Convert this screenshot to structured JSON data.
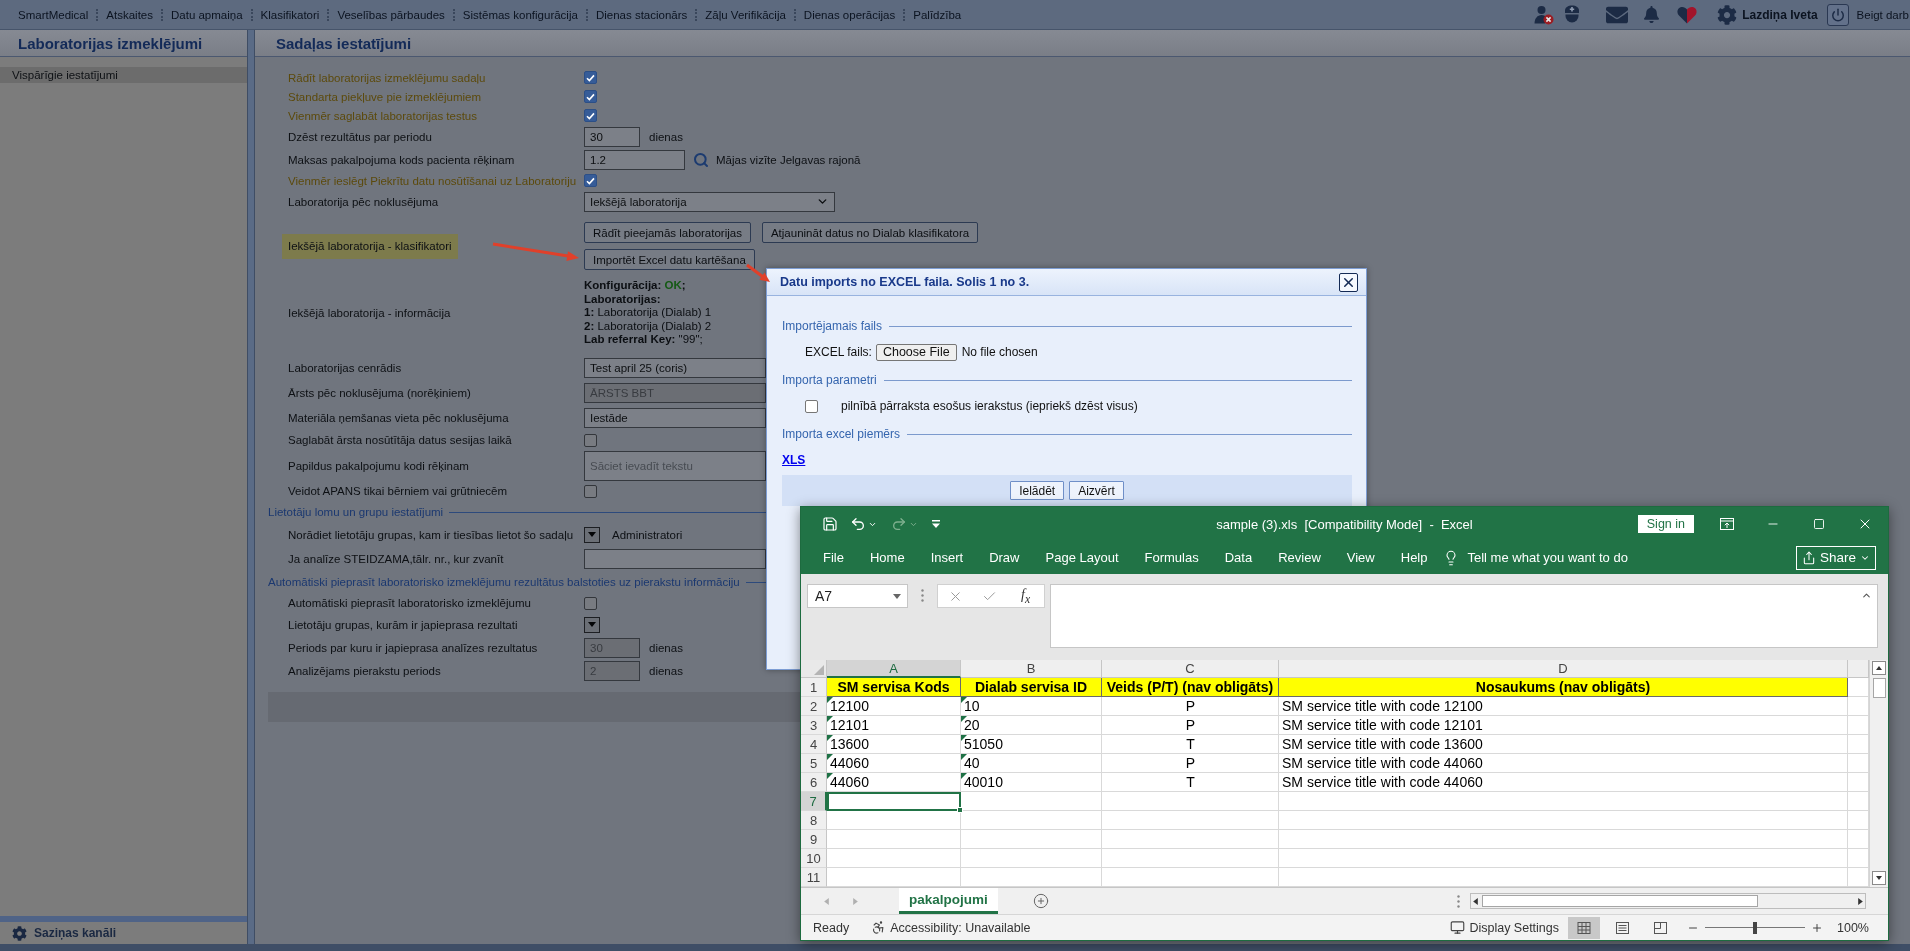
{
  "top_menu": {
    "items": [
      "SmartMedical",
      "Atskaites",
      "Datu apmaiņa",
      "Klasifikatori",
      "Veselības pārbaudes",
      "Sistēmas konfigurācija",
      "Dienas stacionārs",
      "Zāļu Verifikācija",
      "Dienas operācijas",
      "Palīdzība"
    ],
    "user": "Lazdiņa Iveta",
    "logout": "Beigt darb"
  },
  "sidebar": {
    "title": "Laboratorijas izmeklējumi",
    "items": [
      {
        "label": "Vispārīgie iestatījumi",
        "selected": true
      }
    ],
    "footer": "Saziņas kanāli"
  },
  "content": {
    "title": "Sadaļas iestatījumi",
    "rows": [
      {
        "kind": "checkbox",
        "label": "Rādīt laboratorijas izmeklējumu sadaļu",
        "accent": true,
        "highlighted": false,
        "checked": true
      },
      {
        "kind": "checkbox",
        "label": "Standarta piekļuve pie izmeklējumiem",
        "accent": true,
        "highlighted": false,
        "checked": true
      },
      {
        "kind": "checkbox",
        "label": "Vienmēr saglabāt laboratorijas testus",
        "accent": true,
        "highlighted": false,
        "checked": true
      },
      {
        "kind": "number",
        "label": "Dzēst rezultātus par periodu",
        "accent": false,
        "highlighted": false,
        "value": "30",
        "unit": "dienas",
        "disabled": false
      },
      {
        "kind": "lookup",
        "label": "Maksas pakalpojuma kods pacienta rēķinam",
        "accent": false,
        "highlighted": false,
        "value": "1.2",
        "note": "Mājas vizīte Jelgavas rajonā"
      },
      {
        "kind": "checkbox",
        "label": "Vienmēr ieslēgt Piekrītu datu nosūtīšanai uz Laboratoriju",
        "accent": true,
        "highlighted": false,
        "checked": true
      },
      {
        "kind": "select",
        "label": "Laboratorija pēc noklusējuma",
        "accent": false,
        "highlighted": false,
        "value": "Iekšējā laboratorija"
      },
      {
        "kind": "actions",
        "label": "Iekšējā laboratorija - klasifikatori",
        "accent": false,
        "highlighted": true,
        "buttons": [
          "Rādīt pieejamās laboratorijas",
          "Atjaunināt datus no Dialab klasifikatora",
          "Importēt Excel datu kartēšana"
        ]
      },
      {
        "kind": "info",
        "label": "Iekšējā laboratorija - informācija",
        "accent": false,
        "highlighted": false,
        "config": {
          "label": "Konfigurācija:",
          "status": "OK",
          "ok": true,
          "suffix": ";"
        },
        "labs_heading": "Laboratorijas:",
        "labs": [
          "**1:** Laboratorija (Dialab) 1",
          "**2:** Laboratorija (Dialab) 2"
        ],
        "key": "**Lab referral Key:** \"99\";"
      },
      {
        "kind": "select",
        "label": "Laboratorijas cenrādis",
        "accent": false,
        "highlighted": false,
        "value": "Test april 25 (coris)"
      },
      {
        "kind": "text",
        "label": "Ārsts pēc noklusējuma (norēķiniem)",
        "accent": false,
        "highlighted": false,
        "value": "ĀRSTS BBT",
        "disabled": true
      },
      {
        "kind": "select",
        "label": "Materiāla ņemšanas vieta pēc noklusējuma",
        "accent": false,
        "highlighted": false,
        "value": "Iestāde"
      },
      {
        "kind": "checkbox",
        "label": "Saglabāt ārsta nosūtītāja datus sesijas laikā",
        "accent": false,
        "highlighted": false,
        "checked": false
      },
      {
        "kind": "tags",
        "label": "Papildus pakalpojumu kodi rēķinam",
        "accent": false,
        "highlighted": false,
        "placeholder": "Sāciet ievadīt tekstu"
      },
      {
        "kind": "checkbox",
        "label": "Veidot APANS tikai bērniem vai grūtniecēm",
        "accent": false,
        "highlighted": false,
        "checked": false
      },
      {
        "kind": "section",
        "title": "Lietotāju lomu un grupu iestatījumi"
      },
      {
        "kind": "picker",
        "label": "Norādiet lietotāju grupas, kam ir tiesības lietot šo sadaļu",
        "accent": false,
        "highlighted": false,
        "value": "Administratori"
      },
      {
        "kind": "text",
        "label": "Ja analīze STEIDZAMA,tālr. nr., kur zvanīt",
        "accent": false,
        "highlighted": false,
        "disabled": false
      },
      {
        "kind": "section",
        "title": "Automātiski pieprasīt laboratorisko izmeklējumu rezultātus balstoties uz pierakstu informāciju"
      },
      {
        "kind": "checkbox",
        "label": "Automātiski pieprasīt laboratorisko izmeklējumu",
        "accent": false,
        "highlighted": false,
        "checked": false
      },
      {
        "kind": "picker",
        "label": "Lietotāju grupas, kurām ir japieprasa rezultati",
        "accent": false,
        "highlighted": false
      },
      {
        "kind": "number",
        "label": "Periods par kuru ir japieprasa analīzes rezultatus",
        "accent": false,
        "highlighted": false,
        "value": "30",
        "unit": "dienas",
        "disabled": true
      },
      {
        "kind": "number",
        "label": "Analizējams pierakstu periods",
        "accent": false,
        "highlighted": false,
        "value": "2",
        "unit": "dienas",
        "disabled": true
      }
    ]
  },
  "dialog": {
    "title": "Datu imports no EXCEL faila. Solis 1 no 3.",
    "sections": [
      {
        "kind": "file",
        "heading": "Importējamais fails",
        "label": "EXCEL fails:",
        "button": "Choose File",
        "status": "No file chosen"
      },
      {
        "kind": "option",
        "heading": "Importa parametri",
        "label": "pilnībā pārraksta esošus ierakstus (iepriekš dzēst visus)",
        "checked": false
      },
      {
        "kind": "link",
        "heading": "Importa excel piemērs",
        "link": "XLS"
      }
    ],
    "buttons": [
      "Ielādēt",
      "Aizvērt"
    ]
  },
  "excel": {
    "title": "sample (3).xls  [Compatibility Mode]  -  Excel",
    "sign_in": "Sign in",
    "tabs": [
      "File",
      "Home",
      "Insert",
      "Draw",
      "Page Layout",
      "Formulas",
      "Data",
      "Review",
      "View",
      "Help"
    ],
    "tell_me": {
      "placeholder": "Tell me what you want to do"
    },
    "share": "Share",
    "name_box": "A7",
    "function_label": "f$_{x}$",
    "columns": [
      {
        "letter": "A",
        "selected": true,
        "kind": "text"
      },
      {
        "letter": "B",
        "selected": false,
        "kind": "text"
      },
      {
        "letter": "C",
        "selected": false,
        "kind": "code"
      },
      {
        "letter": "D",
        "selected": false,
        "kind": "text"
      }
    ],
    "rows": [
      {
        "number": "1",
        "kind": "header",
        "selected": false,
        "cells": [
          "SM servisa Kods",
          "Dialab servisa ID",
          "Veids (P/T) (nav obligāts)",
          "Nosaukums (nav obligāts)"
        ]
      },
      {
        "number": "2",
        "kind": "data",
        "selected": false,
        "cells": [
          "12100",
          "10",
          "P",
          "SM service title with code 12100"
        ],
        "flags": [
          true,
          true,
          false,
          false
        ]
      },
      {
        "number": "3",
        "kind": "data",
        "selected": false,
        "cells": [
          "12101",
          "20",
          "P",
          "SM service title with code 12101"
        ],
        "flags": [
          true,
          true,
          false,
          false
        ]
      },
      {
        "number": "4",
        "kind": "data",
        "selected": false,
        "cells": [
          "13600",
          "51050",
          "T",
          "SM service title with code 13600"
        ],
        "flags": [
          true,
          true,
          false,
          false
        ]
      },
      {
        "number": "5",
        "kind": "data",
        "selected": false,
        "cells": [
          "44060",
          "40",
          "P",
          "SM service title with code 44060"
        ],
        "flags": [
          true,
          true,
          false,
          false
        ]
      },
      {
        "number": "6",
        "kind": "data",
        "selected": false,
        "cells": [
          "44060",
          "40010",
          "T",
          "SM service title with code 44060"
        ],
        "flags": [
          true,
          true,
          false,
          false
        ]
      },
      {
        "number": "7",
        "kind": "empty",
        "selected": true
      },
      {
        "number": "8",
        "kind": "empty",
        "selected": false
      },
      {
        "number": "9",
        "kind": "empty",
        "selected": false
      },
      {
        "number": "10",
        "kind": "empty",
        "selected": false
      },
      {
        "number": "11",
        "kind": "empty",
        "selected": false
      }
    ],
    "sheets": [
      {
        "label": "pakalpojumi",
        "selected": true
      }
    ],
    "status": "Ready",
    "accessibility": "Accessibility: Unavailable",
    "display_settings": "Display Settings",
    "views": [
      {
        "kind": "normal",
        "selected": true
      },
      {
        "kind": "page_layout",
        "selected": false
      },
      {
        "kind": "page_break",
        "selected": false
      }
    ],
    "zoom": {
      "label": "100%",
      "level": 0.5
    }
  }
}
